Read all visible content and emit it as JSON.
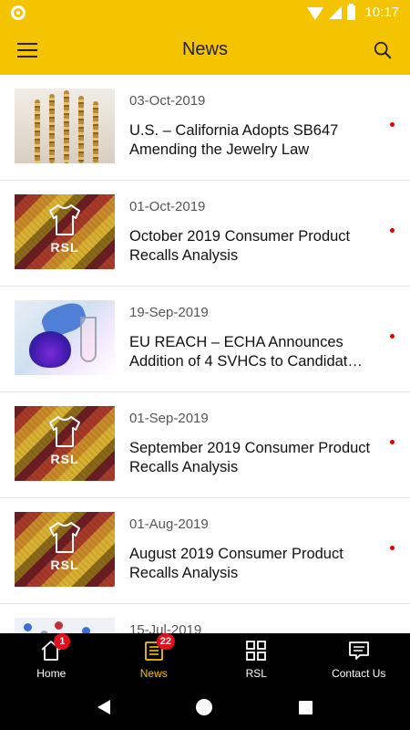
{
  "status_bar": {
    "time": "10:17"
  },
  "app_bar": {
    "title": "News"
  },
  "news": [
    {
      "date": "03-Oct-2019",
      "title": "U.S. – California Adopts SB647 Amending the Jewelry Law",
      "thumbnail": "jewelry-photo",
      "unread": true
    },
    {
      "date": "01-Oct-2019",
      "title": "October 2019 Consumer Product Recalls Analysis",
      "thumbnail": "rsl-fabric",
      "thumb_label": "RSL",
      "unread": true
    },
    {
      "date": "19-Sep-2019",
      "title": "EU REACH – ECHA Announces Addition of 4 SVHCs to Candidat…",
      "thumbnail": "lab-flask-photo",
      "unread": true
    },
    {
      "date": "01-Sep-2019",
      "title": "September 2019 Consumer Product Recalls Analysis",
      "thumbnail": "rsl-fabric",
      "thumb_label": "RSL",
      "unread": true
    },
    {
      "date": "01-Aug-2019",
      "title": "August 2019 Consumer Product Recalls Analysis",
      "thumbnail": "rsl-fabric",
      "thumb_label": "RSL",
      "unread": true
    },
    {
      "date": "15-Jul-2019",
      "title": "",
      "thumbnail": "molecule-photo",
      "unread": false
    }
  ],
  "bottom_nav": [
    {
      "label": "Home",
      "icon": "home-icon",
      "badge": "1",
      "active": false
    },
    {
      "label": "News",
      "icon": "news-icon",
      "badge": "22",
      "active": true
    },
    {
      "label": "RSL",
      "icon": "grid-icon",
      "badge": "",
      "active": false
    },
    {
      "label": "Contact Us",
      "icon": "chat-icon",
      "badge": "",
      "active": false
    }
  ],
  "colors": {
    "brand_yellow": "#F5C400",
    "unread_dot": "#E00000",
    "badge_red": "#E0101E"
  }
}
